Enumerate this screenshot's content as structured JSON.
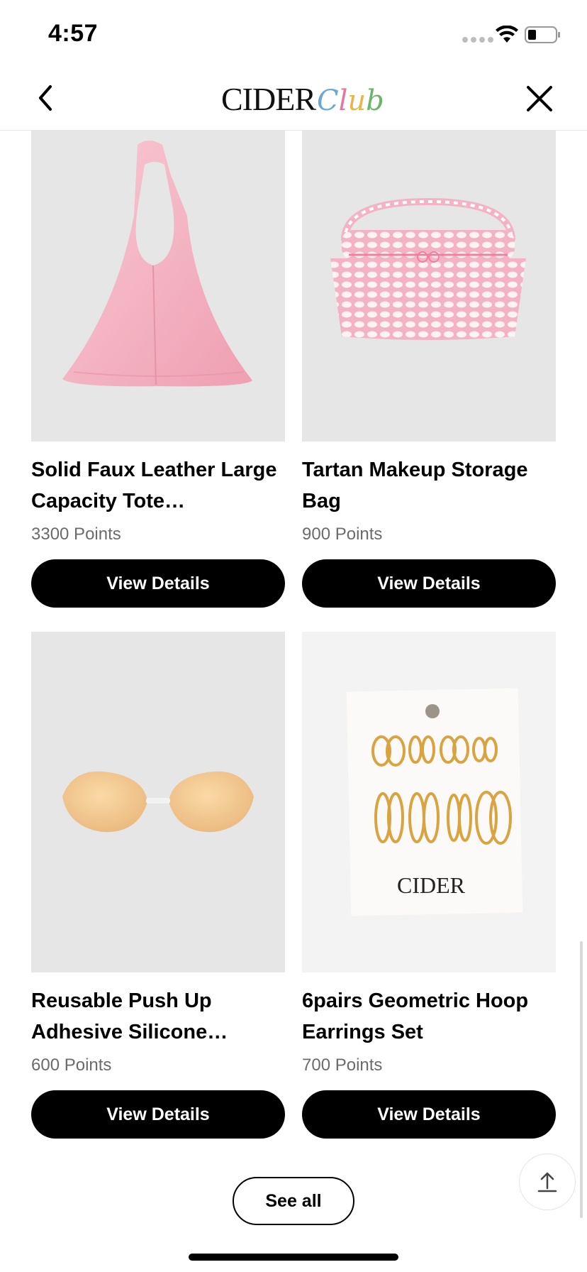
{
  "status_bar": {
    "time": "4:57"
  },
  "header": {
    "logo_main": "CIDER",
    "logo_script": [
      "C",
      "l",
      "u",
      "b"
    ],
    "back_icon": "chevron-left-icon",
    "close_icon": "close-icon"
  },
  "products": [
    {
      "name": "Solid Faux Leather Large Capacity Tote…",
      "points": "3300 Points",
      "button": "View Details"
    },
    {
      "name": "Tartan Makeup Storage Bag",
      "points": "900 Points",
      "button": "View Details"
    },
    {
      "name": "Reusable Push Up Adhesive Silicone…",
      "points": "600 Points",
      "button": "View Details"
    },
    {
      "name": "6pairs Geometric Hoop Earrings Set",
      "points": "700 Points",
      "button": "View Details",
      "package_brand": "CIDER"
    }
  ],
  "see_all_label": "See all",
  "scroll_top_icon": "arrow-up-icon",
  "colors": {
    "button_bg": "#000000",
    "image_bg": "#e6e6e6",
    "points_text": "#6b6b6b",
    "tote_pink": "#f4b6c4"
  }
}
